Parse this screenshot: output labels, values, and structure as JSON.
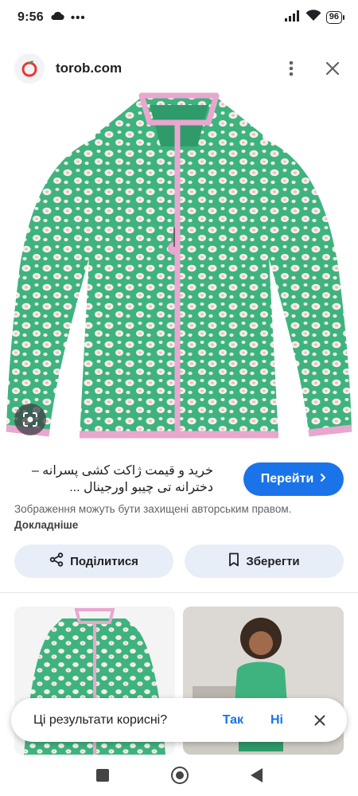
{
  "status_bar": {
    "time": "9:56",
    "extra": "•••",
    "battery": "96"
  },
  "header": {
    "site": "torob.com"
  },
  "result": {
    "title": "خرید و قیمت ژاکت کشی پسرانه – دخترانه تی چیبو اورجینال ...",
    "go_button": "Перейти",
    "copyright": "Зображення можуть бути захищені авторським правом.",
    "more_link": "Докладніше"
  },
  "actions": {
    "share": "Поділитися",
    "save": "Зберегти"
  },
  "feedback": {
    "question": "Ці результати корисні?",
    "yes": "Так",
    "no": "Ні"
  },
  "colors": {
    "accent": "#1a73e8",
    "fleece": "#3fb37f",
    "trim": "#e8a7cf",
    "pill_bg": "#e8eef8"
  },
  "icons": [
    "cloud-icon",
    "signal-icon",
    "wifi-icon",
    "battery-icon",
    "kebab-menu-icon",
    "close-icon",
    "lens-icon",
    "chevron-right-icon",
    "share-icon",
    "bookmark-icon",
    "nav-recents-icon",
    "nav-home-icon",
    "nav-back-icon"
  ]
}
